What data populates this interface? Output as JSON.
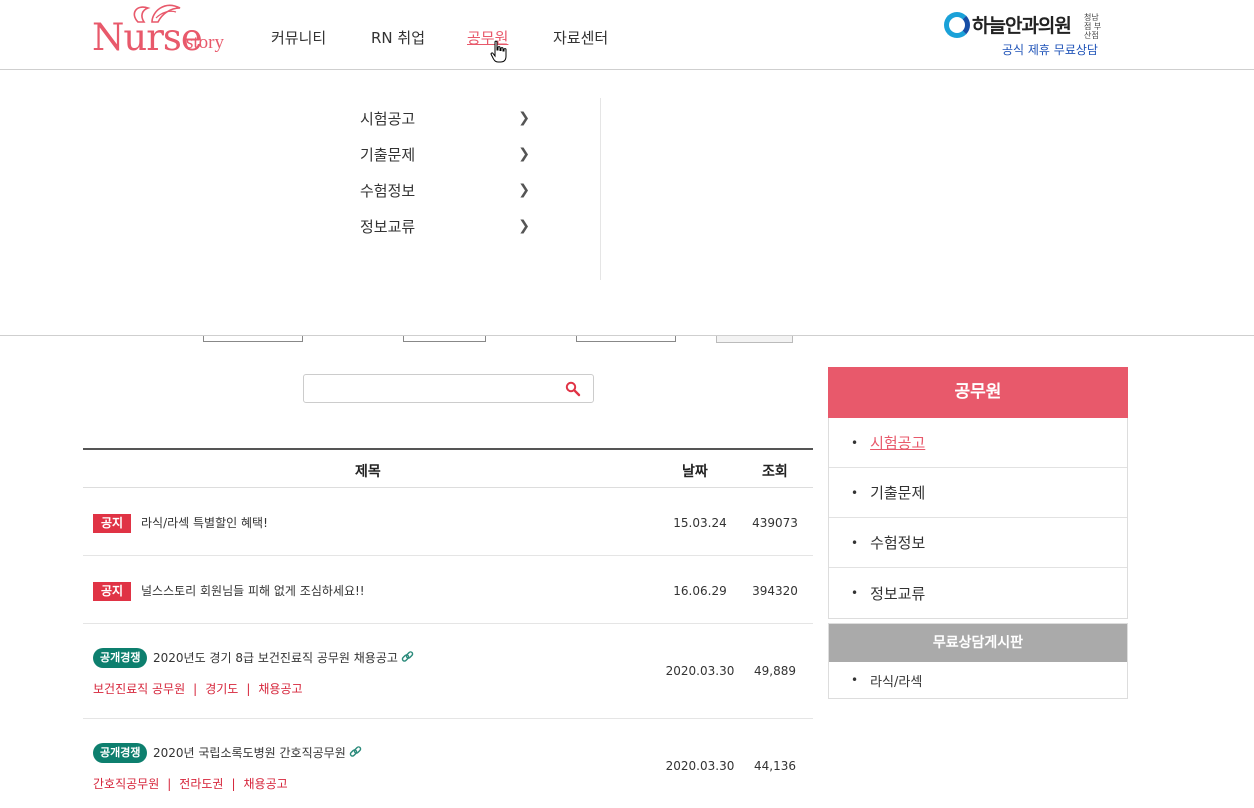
{
  "header": {
    "logo_main": "Nurse",
    "logo_sub": "story",
    "nav": [
      "커뮤니티",
      "RN 취업",
      "공무원",
      "자료센터"
    ],
    "active_nav": "공무원",
    "partner_name": "하늘안과의원",
    "partner_small": "청남점 부산점",
    "partner_sub": "공식 제휴 무료상담"
  },
  "dropdown": {
    "items": [
      "시험공고",
      "기출문제",
      "수험정보",
      "정보교류"
    ]
  },
  "search": {
    "placeholder": ""
  },
  "board": {
    "headers": {
      "title": "제목",
      "date": "날짜",
      "views": "조회"
    },
    "notices": [
      {
        "badge": "공지",
        "title": "라식/라섹 특별할인 혜택!",
        "date": "15.03.24",
        "views": "439073"
      },
      {
        "badge": "공지",
        "title": "널스스토리 회원님들 피해 없게 조심하세요!!",
        "date": "16.06.29",
        "views": "394320"
      }
    ],
    "posts": [
      {
        "category": "공개경쟁",
        "title": "2020년도 경기 8급 보건진료직 공무원 채용공고",
        "tags": [
          "보건진료직 공무원",
          "경기도",
          "채용공고"
        ],
        "date": "2020.03.30",
        "views": "49,889"
      },
      {
        "category": "공개경쟁",
        "title": "2020년 국립소록도병원 간호직공무원",
        "tags": [
          "간호직공무원",
          "전라도권",
          "채용공고"
        ],
        "date": "2020.03.30",
        "views": "44,136"
      }
    ]
  },
  "sidebar": {
    "title": "공무원",
    "items": [
      "시험공고",
      "기출문제",
      "수험정보",
      "정보교류"
    ],
    "active": "시험공고",
    "consult_title": "무료상담게시판",
    "consult_items": [
      "라식/라섹"
    ]
  },
  "colors": {
    "brand": "#e8596b",
    "notice_badge": "#e03345",
    "category_badge": "#0d7f6e",
    "tag": "#d6253b"
  }
}
